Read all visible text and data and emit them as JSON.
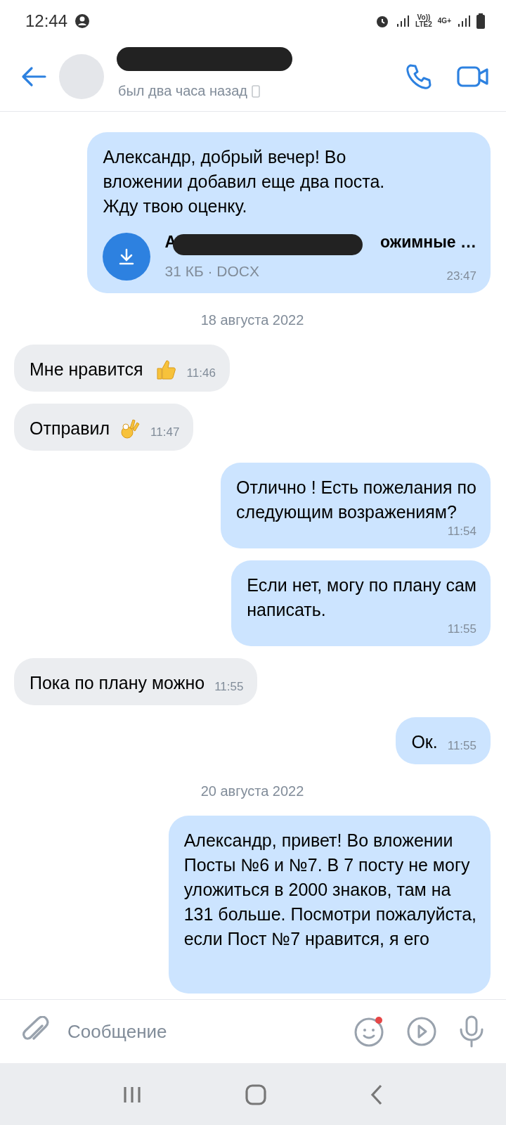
{
  "status_bar": {
    "time": "12:44",
    "volte_top": "Vo))",
    "volte_bottom": "LTE2",
    "network": "4G+"
  },
  "header": {
    "status": "был два часа назад"
  },
  "messages": [
    {
      "kind": "message",
      "outgoing": true,
      "text": "Александр, добрый вечер! Во\nвложении добавил еще два поста.\nЖду твою оценку.",
      "time": "23:47",
      "attachment": {
        "name_start": "А",
        "name_end": "ожимные …",
        "meta": "31 КБ · DOCX"
      }
    },
    {
      "kind": "date",
      "text": "18 августа 2022"
    },
    {
      "kind": "message",
      "outgoing": false,
      "text": "Мне нравится",
      "emoji": {
        "kind": "thumbs-up"
      },
      "time": "11:46"
    },
    {
      "kind": "message",
      "outgoing": false,
      "text": "Отправил",
      "emoji": {
        "kind": "ok-hand"
      },
      "time": "11:47"
    },
    {
      "kind": "message",
      "outgoing": true,
      "text": "Отлично ! Есть пожелания по\nследующим возражениям?",
      "time": "11:54"
    },
    {
      "kind": "message",
      "outgoing": true,
      "text": "Если нет, могу по плану сам\nнаписать.",
      "time": "11:55"
    },
    {
      "kind": "message",
      "outgoing": false,
      "text": "Пока по плану можно",
      "time": "11:55"
    },
    {
      "kind": "message",
      "outgoing": true,
      "text": "Ок.",
      "time": "11:55"
    },
    {
      "kind": "date",
      "text": "20 августа 2022"
    },
    {
      "kind": "message",
      "outgoing": true,
      "text": "Александр, привет! Во вложении\nПосты №6 и №7. В 7 посту не могу\nуложиться в 2000 знаков, там на\n131 больше. Посмотри пожалуйста,\nесли Пост №7 нравится, я его"
    }
  ],
  "composer": {
    "placeholder": "Сообщение",
    "emoji_badge": true
  }
}
